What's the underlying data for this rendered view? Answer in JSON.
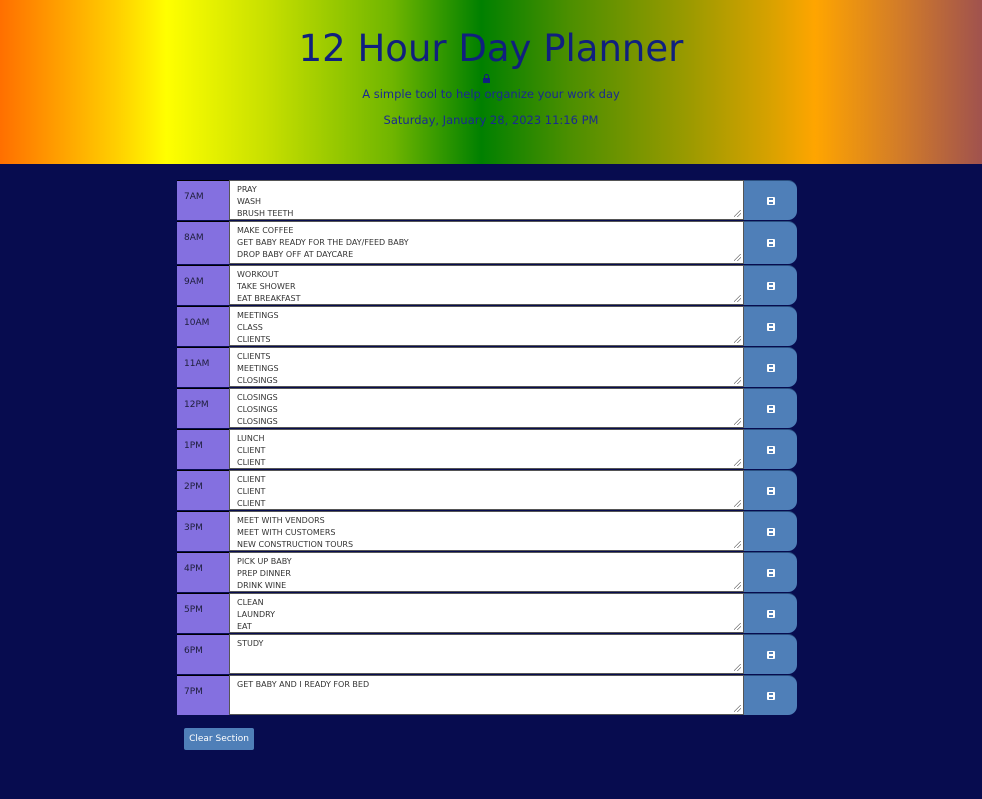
{
  "header": {
    "title": "12 Hour Day Planner",
    "subtitle": "A simple tool to help organize your work day",
    "date": "Saturday, January 28, 2023 11:16 PM"
  },
  "planner": {
    "save_icon": "floppy-disk-icon",
    "rows": [
      {
        "hour": "7AM",
        "text": "PRAY\nWASH\nBRUSH TEETH"
      },
      {
        "hour": "8AM",
        "text": "MAKE COFFEE\nGET BABY READY FOR THE DAY/FEED BABY\nDROP BABY OFF AT DAYCARE"
      },
      {
        "hour": "9AM",
        "text": "WORKOUT\nTAKE SHOWER\nEAT BREAKFAST"
      },
      {
        "hour": "10AM",
        "text": "MEETINGS\nCLASS\nCLIENTS"
      },
      {
        "hour": "11AM",
        "text": "CLIENTS\nMEETINGS\nCLOSINGS"
      },
      {
        "hour": "12PM",
        "text": "CLOSINGS\nCLOSINGS\nCLOSINGS"
      },
      {
        "hour": "1PM",
        "text": "LUNCH\nCLIENT\nCLIENT"
      },
      {
        "hour": "2PM",
        "text": "CLIENT\nCLIENT\nCLIENT"
      },
      {
        "hour": "3PM",
        "text": "MEET WITH VENDORS\nMEET WITH CUSTOMERS\nNEW CONSTRUCTION TOURS"
      },
      {
        "hour": "4PM",
        "text": "PICK UP BABY\nPREP DINNER\nDRINK WINE"
      },
      {
        "hour": "5PM",
        "text": "CLEAN\nLAUNDRY\nEAT"
      },
      {
        "hour": "6PM",
        "text": "STUDY"
      },
      {
        "hour": "7PM",
        "text": "GET BABY AND I READY FOR BED"
      }
    ]
  },
  "footer": {
    "clear_label": "Clear Section"
  }
}
